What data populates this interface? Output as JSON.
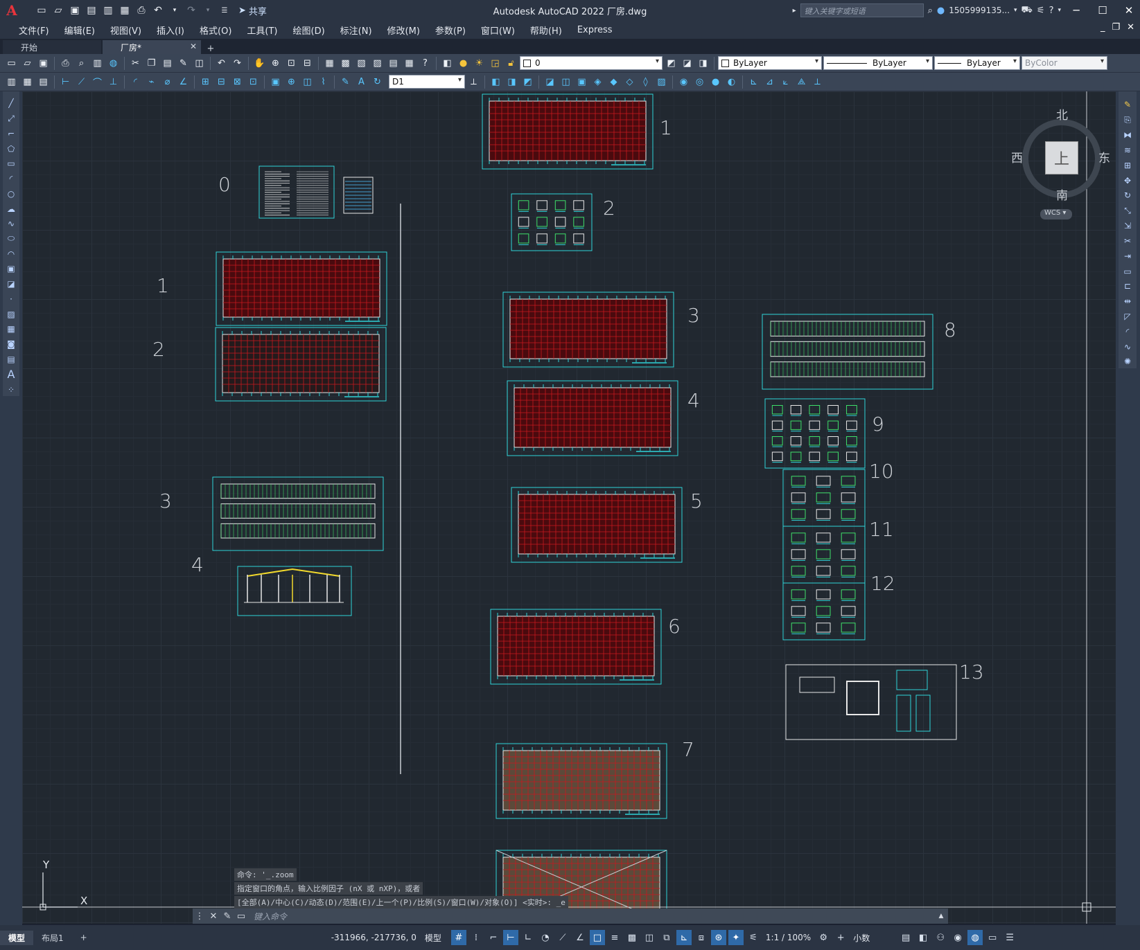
{
  "app": {
    "title": "Autodesk AutoCAD 2022    厂房.dwg",
    "logo": "A",
    "share_label": "共享"
  },
  "search": {
    "placeholder": "键入关键字或短语"
  },
  "user": {
    "name": "1505999135..."
  },
  "menu": [
    "文件(F)",
    "编辑(E)",
    "视图(V)",
    "插入(I)",
    "格式(O)",
    "工具(T)",
    "绘图(D)",
    "标注(N)",
    "修改(M)",
    "参数(P)",
    "窗口(W)",
    "帮助(H)",
    "Express"
  ],
  "doc_tabs": [
    {
      "label": "开始"
    },
    {
      "label": "厂房*"
    }
  ],
  "props": {
    "layer": "0",
    "color": "ByLayer",
    "linetype": "ByLayer",
    "lineweight": "ByLayer",
    "plotstyle": "ByColor",
    "dimstyle": "D1"
  },
  "viewcube": {
    "north": "北",
    "south": "南",
    "west": "西",
    "east": "东",
    "face": "上",
    "wcs": "WCS"
  },
  "ucs": {
    "x": "X",
    "y": "Y"
  },
  "sheets_left": [
    "0",
    "1",
    "2",
    "3",
    "4"
  ],
  "sheets_mid": [
    "1",
    "2",
    "3",
    "4",
    "5",
    "6",
    "7"
  ],
  "sheets_right": [
    "8",
    "9",
    "10",
    "11",
    "12",
    "13"
  ],
  "command": {
    "history": [
      "命令: '_.zoom",
      "指定窗口的角点，输入比例因子 (nX 或 nXP)，或者",
      "[全部(A)/中心(C)/动态(D)/范围(E)/上一个(P)/比例(S)/窗口(W)/对象(O)] <实时>: _e"
    ],
    "placeholder": "键入命令"
  },
  "status": {
    "tabs": [
      "模型",
      "布局1"
    ],
    "coords": "-311966, -217736, 0",
    "mode": "模型",
    "scale": "1:1 / 100%",
    "units": "小数"
  },
  "colors": {
    "grid": "#2b333d",
    "sheet_border": "#2fd3d8",
    "red_fill": "#5a0b10"
  }
}
